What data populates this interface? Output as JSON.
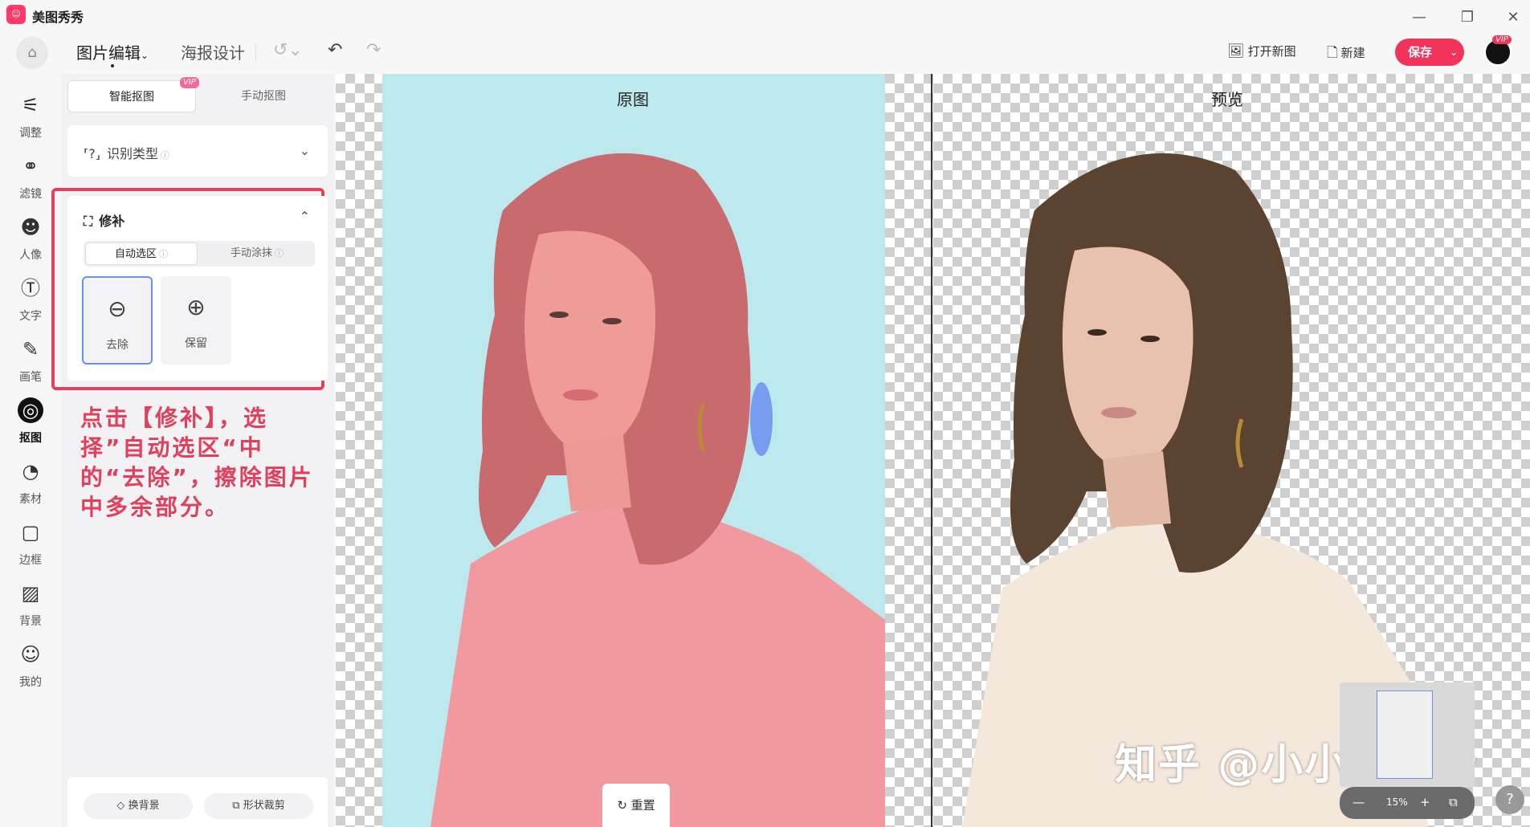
{
  "app": {
    "name": "美图秀秀",
    "logo_icon": "meitu-logo-icon"
  },
  "window": {
    "min_icon": "minimize-icon",
    "restore_icon": "restore-icon",
    "close_icon": "close-icon"
  },
  "topbar": {
    "tabs": [
      "图片编辑",
      "海报设计"
    ],
    "open_new": "打开新图",
    "new": "新建",
    "save": "保存",
    "save_color": "#f2345a",
    "vip": "VIP"
  },
  "leftnav": [
    {
      "label": "调整",
      "icon": "sliders-icon"
    },
    {
      "label": "滤镜",
      "icon": "filter-circles-icon"
    },
    {
      "label": "人像",
      "icon": "portrait-icon"
    },
    {
      "label": "文字",
      "icon": "text-icon"
    },
    {
      "label": "画笔",
      "icon": "brush-icon"
    },
    {
      "label": "抠图",
      "icon": "cutout-icon",
      "active": true
    },
    {
      "label": "素材",
      "icon": "sticker-icon"
    },
    {
      "label": "边框",
      "icon": "frame-icon"
    },
    {
      "label": "背景",
      "icon": "background-icon"
    },
    {
      "label": "我的",
      "icon": "user-icon"
    }
  ],
  "panel": {
    "modes": [
      "智能抠图",
      "手动抠图"
    ],
    "vip_tag": "VIP",
    "recognize_type": "识别类型",
    "repair": {
      "title": "修补",
      "subtabs": [
        "自动选区",
        "手动涂抹"
      ],
      "tools": [
        {
          "label": "去除",
          "icon": "remove-selection-icon"
        },
        {
          "label": "保留",
          "icon": "keep-selection-icon"
        }
      ]
    },
    "annotation": "点击【修补】，选择”自动选区“中的“去除”，擦除图片中多余部分。",
    "annotation_color": "#e0405d",
    "bottom": [
      "换背景",
      "形状裁剪"
    ]
  },
  "canvas": {
    "original_title": "原图",
    "preview_title": "预览",
    "reset": "重置",
    "zoom": "15%",
    "watermark": "知乎 @小小小茶叶",
    "help": "?"
  }
}
